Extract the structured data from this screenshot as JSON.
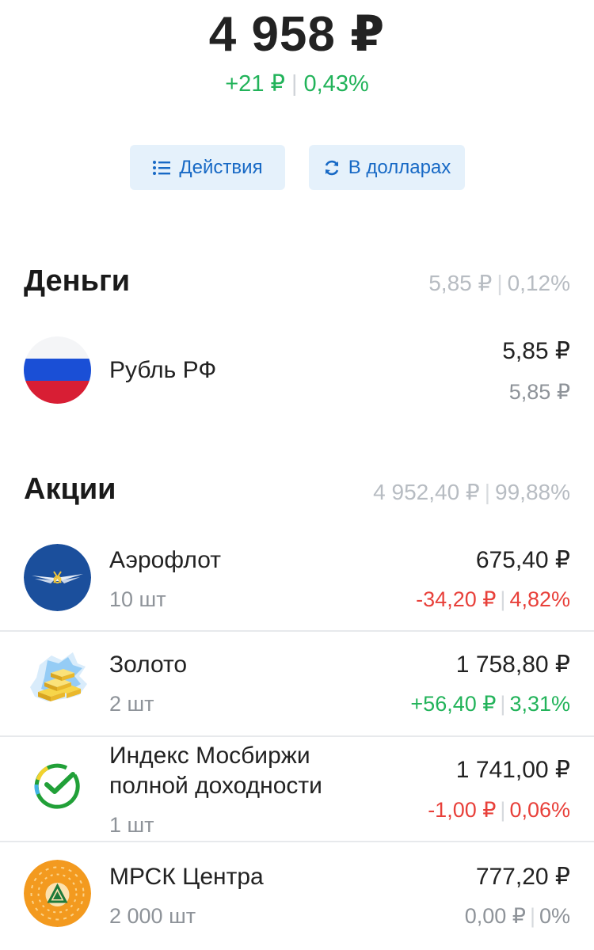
{
  "summary": {
    "total": "4 958 ₽",
    "change_abs": "+21 ₽",
    "change_pct": "0,43%"
  },
  "buttons": {
    "actions_label": "Действия",
    "usd_label": "В долларах",
    "actions_icon": "list-icon",
    "usd_icon": "refresh-icon"
  },
  "colors": {
    "positive": "#22b35a",
    "negative": "#e8403a",
    "button_bg": "#e5f1fb",
    "button_text": "#1769c5"
  },
  "money": {
    "title": "Деньги",
    "summary_abs": "5,85 ₽",
    "summary_pct": "0,12%",
    "items": [
      {
        "name": "Рубль РФ",
        "value": "5,85 ₽",
        "sub_value": "5,85 ₽",
        "icon": "russian-flag-icon"
      }
    ]
  },
  "stocks": {
    "title": "Акции",
    "summary_abs": "4 952,40 ₽",
    "summary_pct": "99,88%",
    "items": [
      {
        "name": "Аэрофлот",
        "qty": "10 шт",
        "value": "675,40 ₽",
        "delta_abs": "-34,20 ₽",
        "delta_pct": "4,82%",
        "trend": "negative",
        "icon": "aeroflot-logo-icon"
      },
      {
        "name": "Золото",
        "qty": "2 шт",
        "value": "1 758,80 ₽",
        "delta_abs": "+56,40 ₽",
        "delta_pct": "3,31%",
        "trend": "positive",
        "icon": "gold-bars-icon"
      },
      {
        "name_line1": "Индекс Мосбиржи",
        "name_line2": "полной доходности",
        "qty": "1 шт",
        "value": "1 741,00 ₽",
        "delta_abs": "-1,00 ₽",
        "delta_pct": "0,06%",
        "trend": "negative",
        "icon": "sber-logo-icon"
      },
      {
        "name": "МРСК Центра",
        "qty": "2 000 шт",
        "value": "777,20 ₽",
        "delta_abs": "0,00 ₽",
        "delta_pct": "0%",
        "trend": "neutral",
        "icon": "mrsk-logo-icon"
      }
    ]
  }
}
